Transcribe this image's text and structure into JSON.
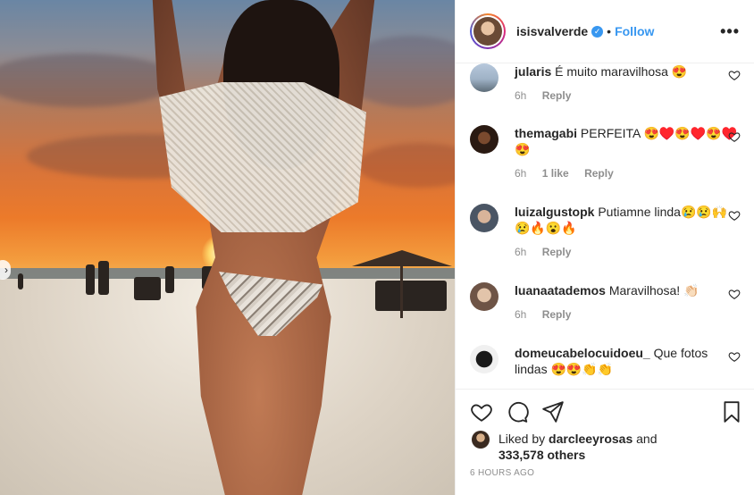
{
  "post": {
    "username": "isisvalverde",
    "separator": "•",
    "follow_label": "Follow",
    "more_label": "•••",
    "verified_glyph": "✓",
    "nav_arrow_glyph": "›"
  },
  "comments": [
    {
      "user": "jularis",
      "text": "É muito maravilhosa 😍",
      "time": "6h",
      "likes": "",
      "reply": "Reply"
    },
    {
      "user": "themagabi",
      "text": "PERFEITA 😍♥️😍♥️😍♥️😍",
      "time": "6h",
      "likes": "1 like",
      "reply": "Reply"
    },
    {
      "user": "luizalgustopk",
      "text": "Putiamne linda😢😢🙌😢🔥😮🔥",
      "time": "6h",
      "likes": "",
      "reply": "Reply"
    },
    {
      "user": "luanaatademos",
      "text": "Maravilhosa! 👏🏻",
      "time": "6h",
      "likes": "",
      "reply": "Reply"
    },
    {
      "user": "domeucabelocuidoeu_",
      "text": "Que fotos lindas 😍😍👏👏",
      "time": "",
      "likes": "",
      "reply": ""
    }
  ],
  "icons": {
    "like": "heart-icon",
    "comment": "comment-icon",
    "share": "share-icon",
    "save": "bookmark-icon"
  },
  "likes": {
    "prefix": "Liked by",
    "user": "darcleeyrosas",
    "and": "and",
    "count": "333,578 others"
  },
  "timestamp": "6 HOURS AGO",
  "colors": {
    "accent": "#3897f0",
    "text": "#262626",
    "muted": "#8e8e8e",
    "border": "#efefef"
  }
}
